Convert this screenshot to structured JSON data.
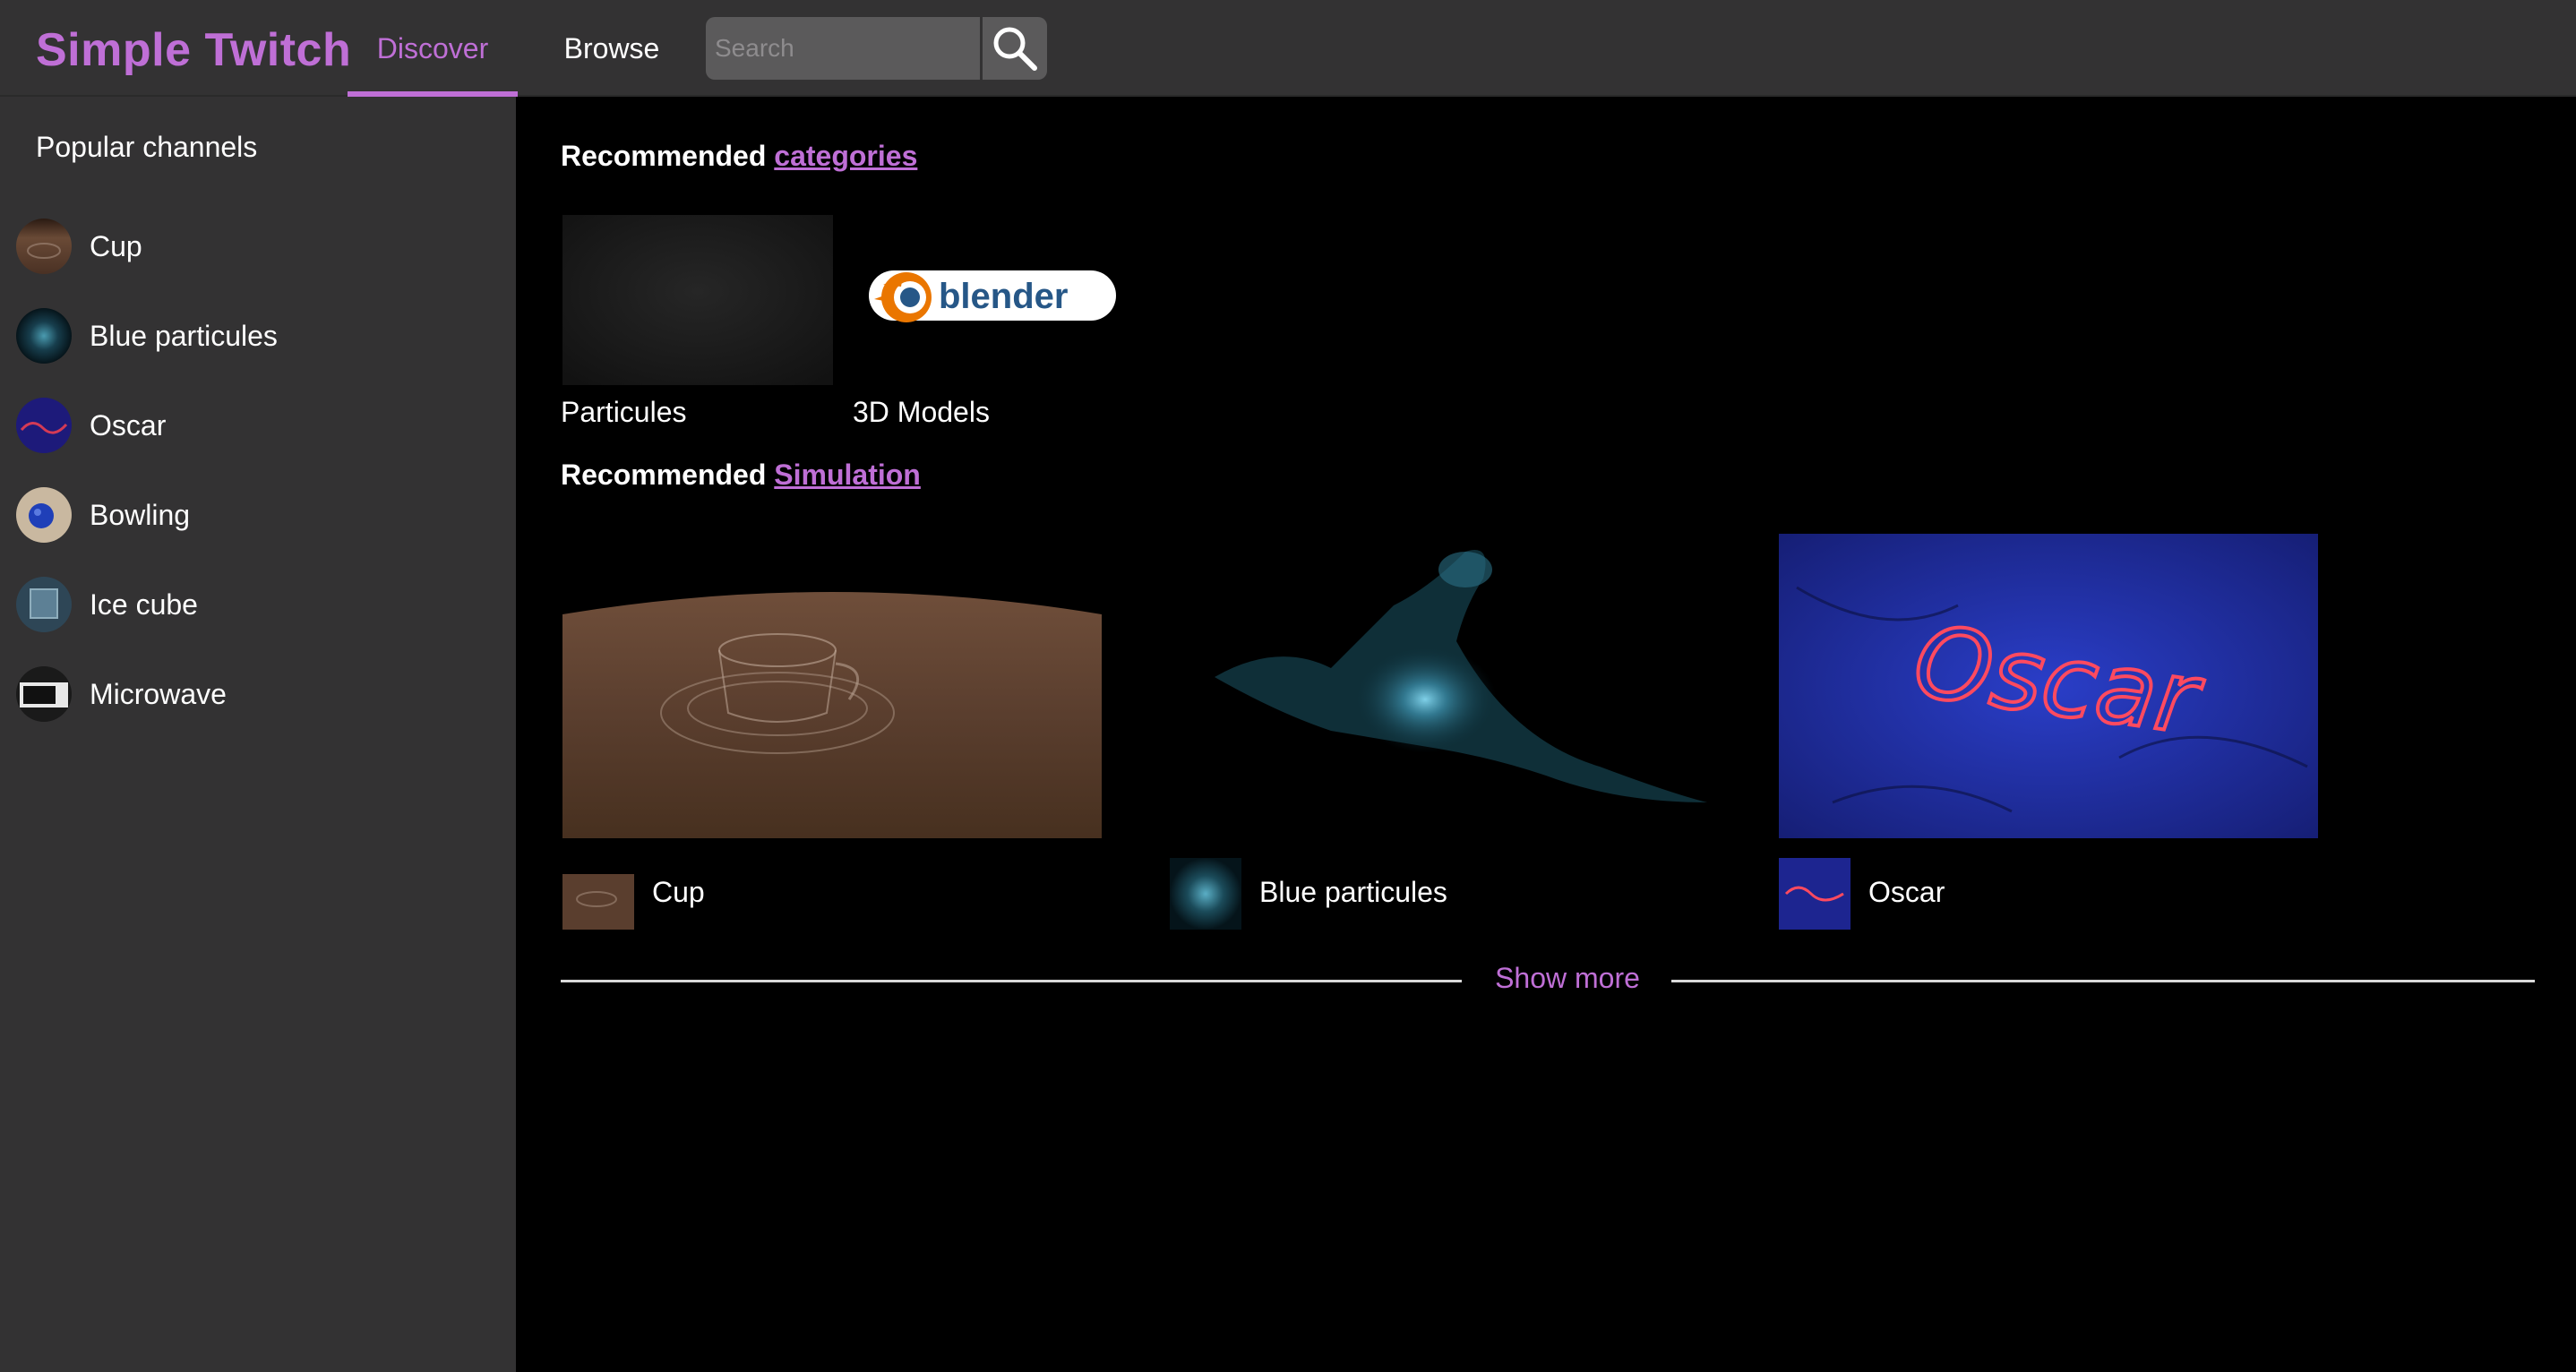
{
  "header": {
    "brand": "Simple Twitch",
    "tabs": [
      {
        "label": "Discover",
        "active": true
      },
      {
        "label": "Browse",
        "active": false
      }
    ],
    "search": {
      "placeholder": "Search",
      "value": "",
      "button_icon": "search-icon"
    }
  },
  "sidebar": {
    "title": "Popular channels",
    "channels": [
      {
        "label": "Cup"
      },
      {
        "label": "Blue particules"
      },
      {
        "label": "Oscar"
      },
      {
        "label": "Bowling"
      },
      {
        "label": "Ice cube"
      },
      {
        "label": "Microwave"
      }
    ]
  },
  "main": {
    "categories_section": {
      "prefix": "Recommended",
      "link": "categories",
      "items": [
        {
          "label": "Particules"
        },
        {
          "label": "3D Models",
          "logo_text": "blender"
        }
      ]
    },
    "simulation_section": {
      "prefix": "Recommended",
      "link": "Simulation",
      "streams": [
        {
          "name": "Cup"
        },
        {
          "name": "Blue particules"
        },
        {
          "name": "Oscar",
          "thumb_text": "Oscar"
        }
      ]
    },
    "show_more": "Show more"
  },
  "colors": {
    "accent": "#bf6fd6",
    "panel": "#333233",
    "background": "#000000"
  }
}
